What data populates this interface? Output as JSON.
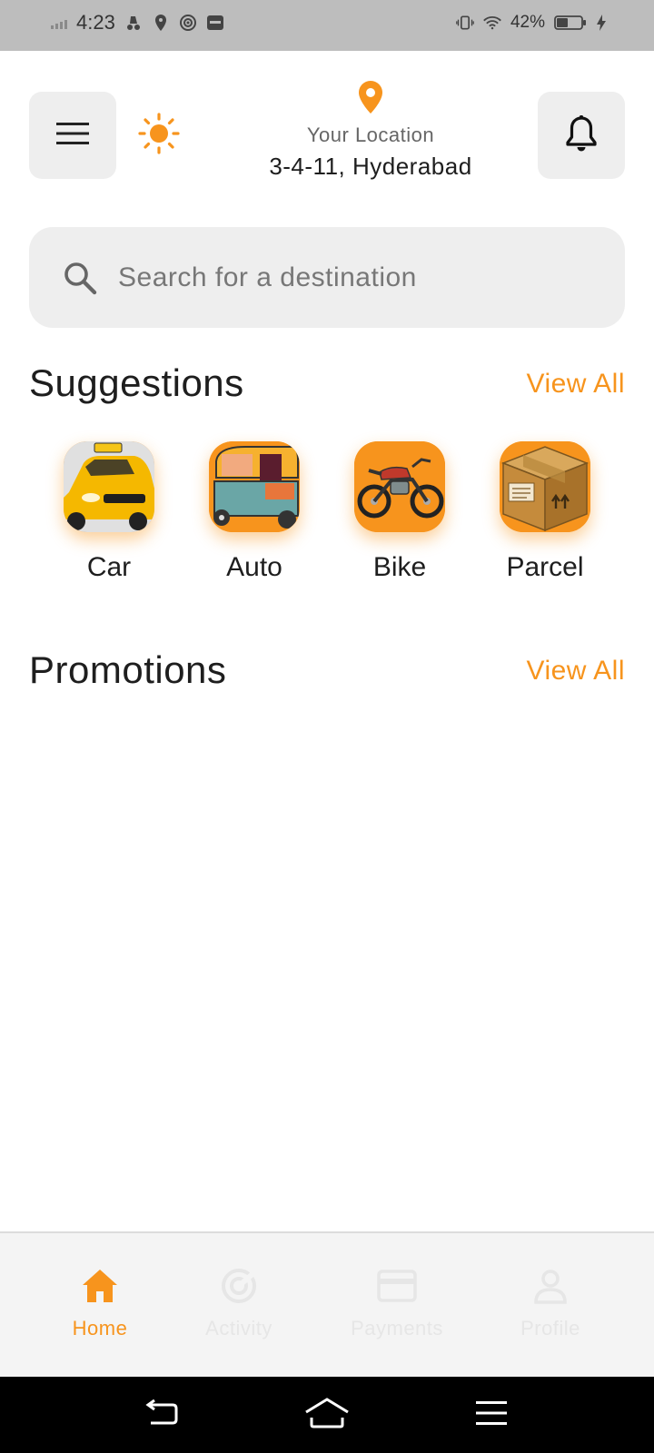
{
  "status_bar": {
    "time": "4:23",
    "battery": "42%"
  },
  "header": {
    "location_label": "Your Location",
    "location_value": "3-4-11, Hyderabad"
  },
  "search": {
    "placeholder": "Search for a destination"
  },
  "suggestions": {
    "title": "Suggestions",
    "view_all": "View All",
    "items": [
      {
        "label": "Car",
        "icon": "taxi-car-icon"
      },
      {
        "label": "Auto",
        "icon": "auto-rickshaw-icon"
      },
      {
        "label": "Bike",
        "icon": "motorbike-icon"
      },
      {
        "label": "Parcel",
        "icon": "parcel-box-icon"
      }
    ]
  },
  "promotions": {
    "title": "Promotions",
    "view_all": "View All"
  },
  "bottom_nav": {
    "items": [
      {
        "label": "Home",
        "icon": "home-icon",
        "active": true
      },
      {
        "label": "Activity",
        "icon": "activity-icon",
        "active": false
      },
      {
        "label": "Payments",
        "icon": "card-icon",
        "active": false
      },
      {
        "label": "Profile",
        "icon": "person-icon",
        "active": false
      }
    ]
  },
  "colors": {
    "accent": "#f7941d",
    "tile_bg": "#eeeeee",
    "status_bar_bg": "#bdbdbd"
  }
}
